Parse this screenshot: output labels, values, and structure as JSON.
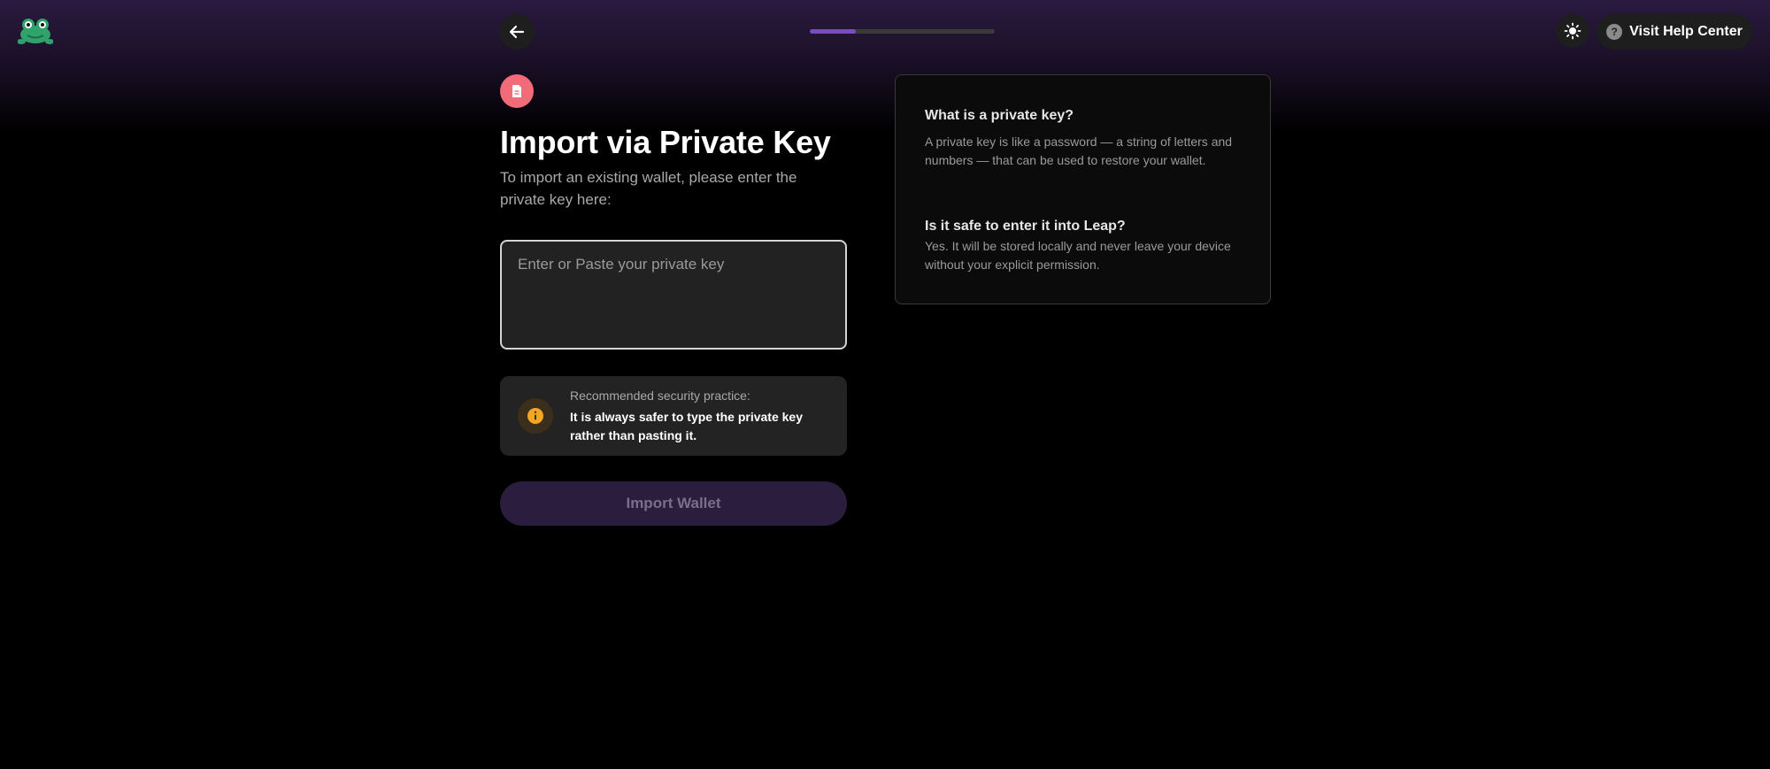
{
  "header": {
    "logo_icon": "frog-logo-icon",
    "back_icon": "arrow-left-icon",
    "progress_fraction": 0.25,
    "theme_icon": "sun-icon",
    "help_label": "Visit Help Center",
    "help_icon": "question-circle-icon"
  },
  "main": {
    "header_icon": "document-icon",
    "title": "Import via Private Key",
    "subtitle": "To import an existing wallet, please enter the private key here:",
    "input": {
      "placeholder": "Enter or Paste your private key",
      "value": ""
    },
    "notice": {
      "icon": "info-icon",
      "label": "Recommended security practice:",
      "text": "It is always safer to type the private key rather than pasting it."
    },
    "import_button": "Import Wallet"
  },
  "info": {
    "faq": [
      {
        "question": "What is a private key?",
        "answer": "A private key is like a password — a string of letters and numbers — that can be used to restore your wallet."
      },
      {
        "question": "Is it safe to enter it into Leap?",
        "answer": "Yes. It will be stored locally and never leave your device without your explicit permission."
      }
    ]
  },
  "colors": {
    "accent": "#7a4cc2",
    "doc_icon_bg": "#f26b79",
    "info_icon": "#f5a623",
    "button_bg": "#2a1d3e"
  }
}
